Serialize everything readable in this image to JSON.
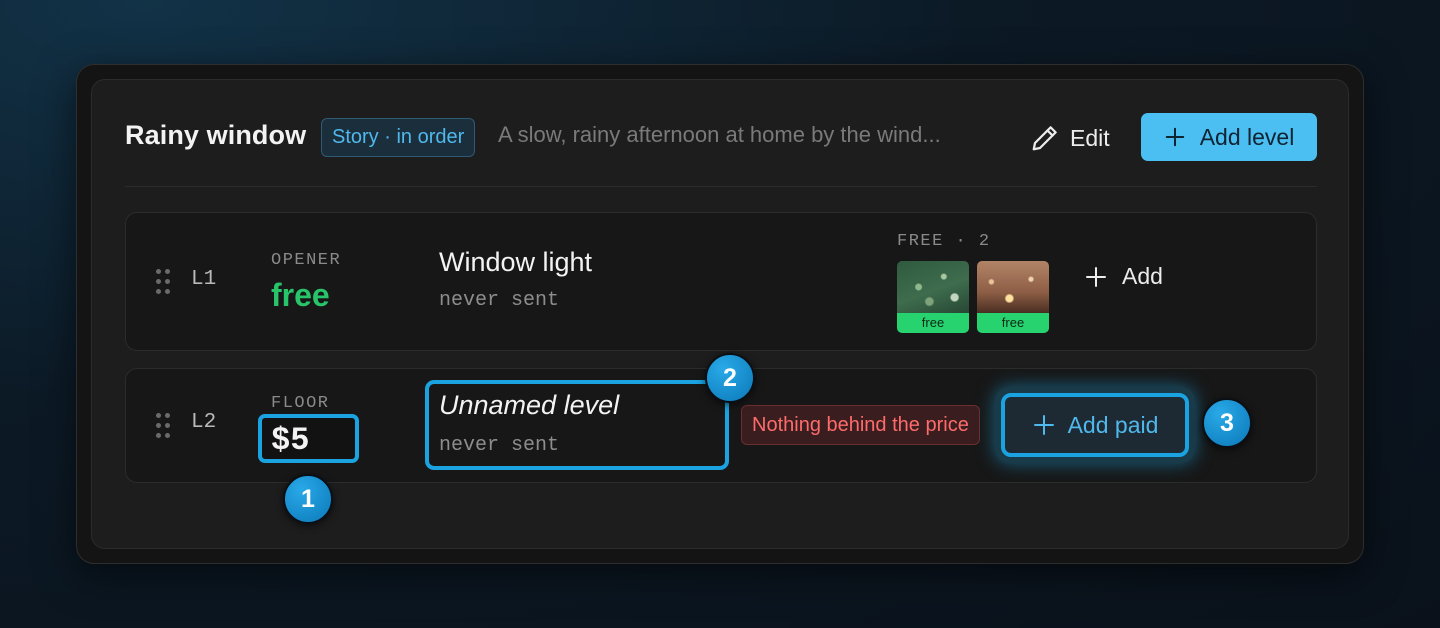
{
  "header": {
    "title": "Rainy window",
    "badge": "Story · in order",
    "description": "A slow, rainy afternoon at home by the wind...",
    "edit_label": "Edit",
    "add_level_label": "Add level"
  },
  "levels": [
    {
      "id": "L1",
      "kind": "OPENER",
      "price": "free",
      "name": "Window light",
      "status": "never sent",
      "free_count": "FREE · 2",
      "thumbnails": [
        {
          "tag": "free"
        },
        {
          "tag": "free"
        }
      ],
      "add_label": "Add"
    },
    {
      "id": "L2",
      "kind": "FLOOR",
      "price": "$5",
      "name": "Unnamed level",
      "status": "never sent",
      "warning": "Nothing behind the price",
      "add_paid_label": "Add paid"
    }
  ],
  "markers": [
    "1",
    "2",
    "3"
  ],
  "colors": {
    "accent": "#4cbff2",
    "free_green": "#27c46a",
    "warning_red": "#ff6b6b",
    "highlight": "#1aa3e0"
  }
}
